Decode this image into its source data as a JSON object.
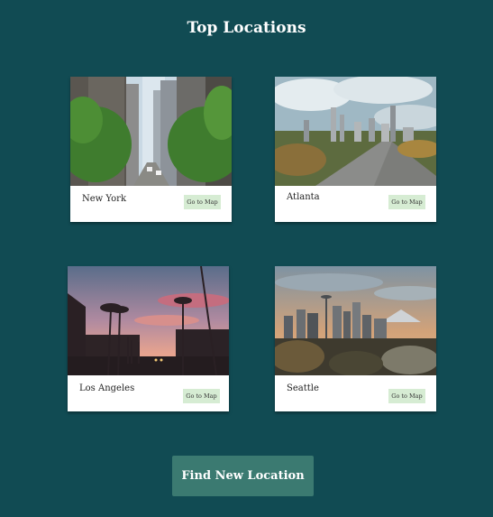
{
  "page": {
    "title": "Top Locations"
  },
  "locations": [
    {
      "city": "New York",
      "button": "Go to Map",
      "photo_icon": "new-york-street-photo"
    },
    {
      "city": "Atlanta",
      "button": "Go to Map",
      "photo_icon": "atlanta-skyline-photo"
    },
    {
      "city": "Los Angeles",
      "button": "Go to Map",
      "photo_icon": "los-angeles-palms-photo"
    },
    {
      "city": "Seattle",
      "button": "Go to Map",
      "photo_icon": "seattle-skyline-photo"
    }
  ],
  "actions": {
    "find_new_location": "Find New Location"
  },
  "colors": {
    "background": "#114b53",
    "card": "#ffffff",
    "map_button": "#d6ecd3",
    "primary_button": "#3b7a71"
  }
}
